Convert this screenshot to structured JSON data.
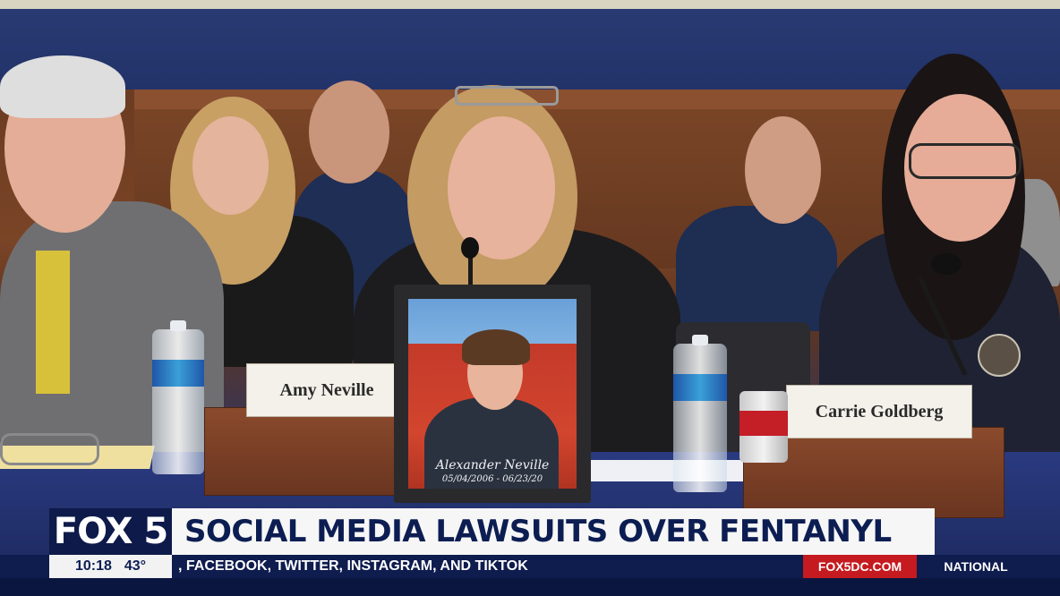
{
  "scene": {
    "nameplate_left": "Amy Neville",
    "nameplate_right": "Carrie Goldberg",
    "photo_caption_name": "Alexander Neville",
    "photo_caption_dates": "05/04/2006 - 06/23/20"
  },
  "lower_third": {
    "station_logo": "FOX 5",
    "headline": "SOCIAL MEDIA LAWSUITS OVER FENTANYL",
    "time": "10:18",
    "temperature": "43°",
    "ticker": ", FACEBOOK, TWITTER, INSTAGRAM, AND TIKTOK",
    "website": "FOX5DC.COM",
    "segment": "NATIONAL"
  }
}
